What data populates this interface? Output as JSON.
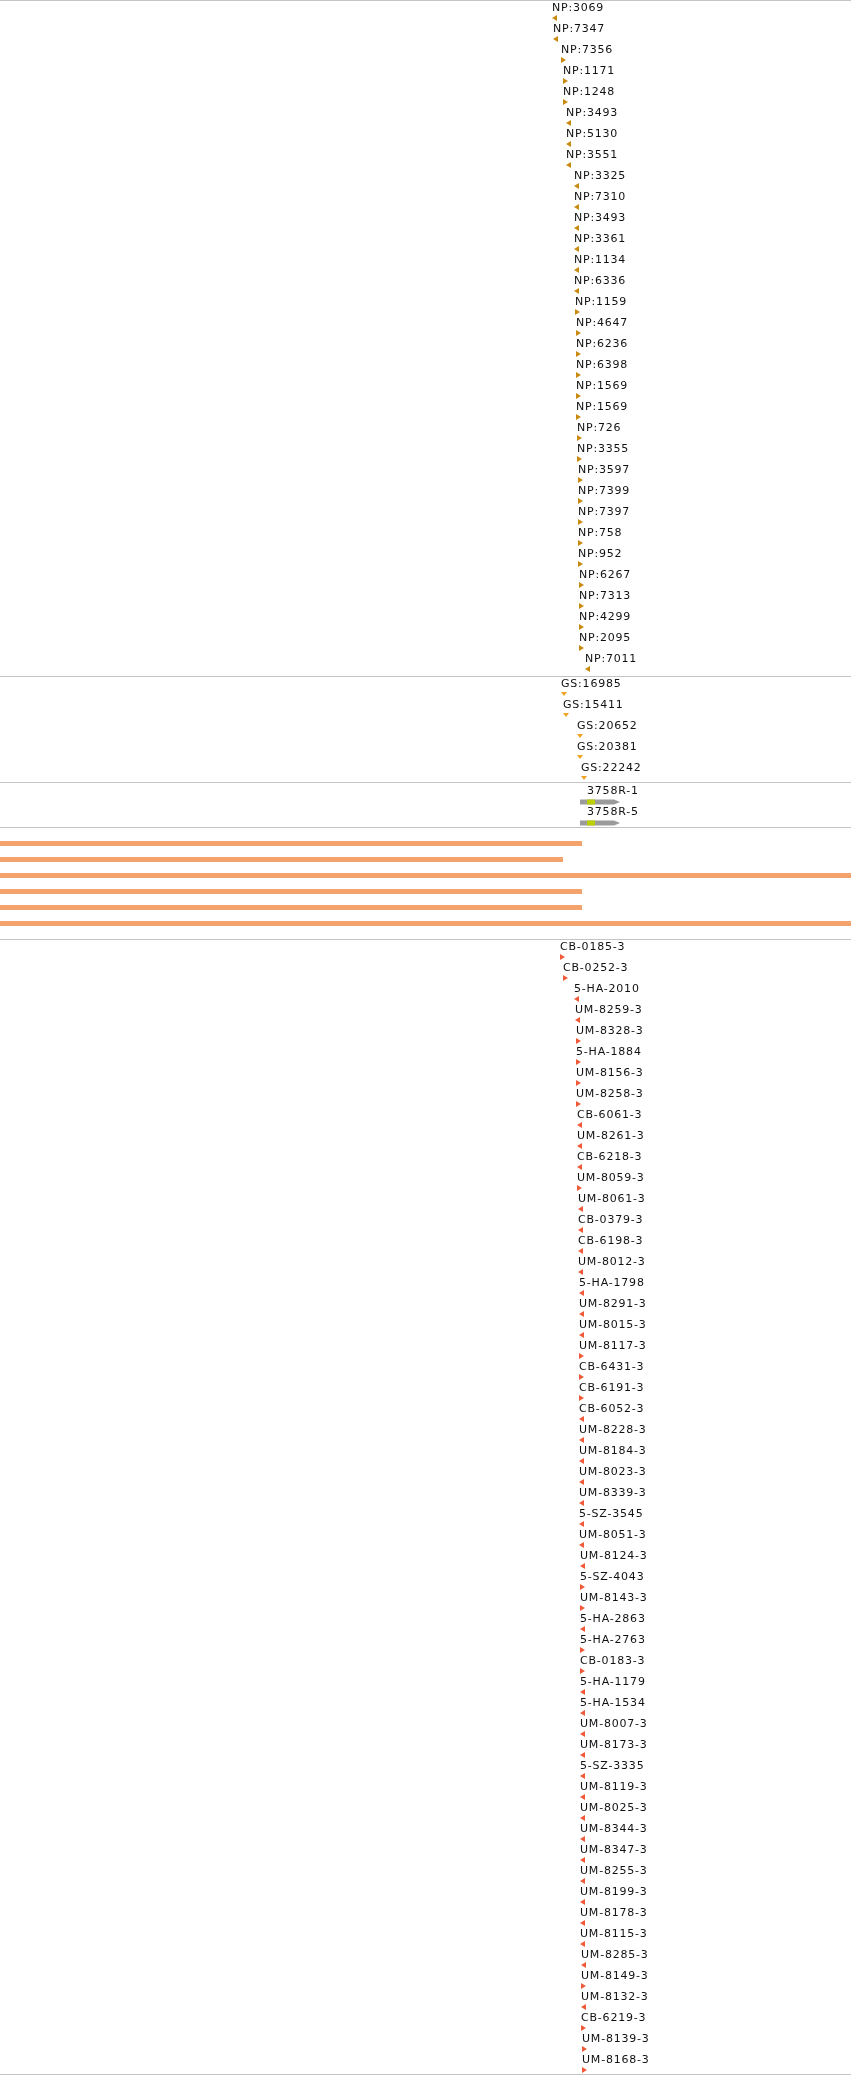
{
  "np_track": {
    "features": [
      {
        "label": "NP:3069",
        "reverse": true
      },
      {
        "label": "NP:7347",
        "reverse": true
      },
      {
        "label": "NP:7356",
        "reverse": false
      },
      {
        "label": "NP:1171",
        "reverse": false
      },
      {
        "label": "NP:1248",
        "reverse": false
      },
      {
        "label": "NP:3493",
        "reverse": true
      },
      {
        "label": "NP:5130",
        "reverse": true
      },
      {
        "label": "NP:3551",
        "reverse": true
      },
      {
        "label": "NP:3325",
        "reverse": true
      },
      {
        "label": "NP:7310",
        "reverse": true
      },
      {
        "label": "NP:3493",
        "reverse": true
      },
      {
        "label": "NP:3361",
        "reverse": true
      },
      {
        "label": "NP:1134",
        "reverse": true
      },
      {
        "label": "NP:6336",
        "reverse": true
      },
      {
        "label": "NP:1159",
        "reverse": false
      },
      {
        "label": "NP:4647",
        "reverse": false
      },
      {
        "label": "NP:6236",
        "reverse": false
      },
      {
        "label": "NP:6398",
        "reverse": false
      },
      {
        "label": "NP:1569",
        "reverse": false
      },
      {
        "label": "NP:1569",
        "reverse": false
      },
      {
        "label": "NP:726",
        "reverse": false
      },
      {
        "label": "NP:3355",
        "reverse": false
      },
      {
        "label": "NP:3597",
        "reverse": false
      },
      {
        "label": "NP:7399",
        "reverse": false
      },
      {
        "label": "NP:7397",
        "reverse": false
      },
      {
        "label": "NP:758",
        "reverse": false
      },
      {
        "label": "NP:952",
        "reverse": false
      },
      {
        "label": "NP:6267",
        "reverse": false
      },
      {
        "label": "NP:7313",
        "reverse": false
      },
      {
        "label": "NP:4299",
        "reverse": false
      },
      {
        "label": "NP:2095",
        "reverse": false
      },
      {
        "label": "NP:7011",
        "reverse": true
      }
    ]
  },
  "gs_track": {
    "features": [
      {
        "label": "GS:16985"
      },
      {
        "label": "GS:15411"
      },
      {
        "label": "GS:20652"
      },
      {
        "label": "GS:20381"
      },
      {
        "label": "GS:22242"
      }
    ]
  },
  "transcript_track": {
    "features": [
      {
        "label": "3758R-1"
      },
      {
        "label": "3758R-5"
      }
    ]
  },
  "cb_track": {
    "features": [
      {
        "label": "CB-0185-3",
        "reverse": false
      },
      {
        "label": "CB-0252-3",
        "reverse": false
      },
      {
        "label": "5-HA-2010",
        "reverse": true
      },
      {
        "label": "UM-8259-3",
        "reverse": true
      },
      {
        "label": "UM-8328-3",
        "reverse": false
      },
      {
        "label": "5-HA-1884",
        "reverse": false
      },
      {
        "label": "UM-8156-3",
        "reverse": false
      },
      {
        "label": "UM-8258-3",
        "reverse": false
      },
      {
        "label": "CB-6061-3",
        "reverse": true
      },
      {
        "label": "UM-8261-3",
        "reverse": true
      },
      {
        "label": "CB-6218-3",
        "reverse": true
      },
      {
        "label": "UM-8059-3",
        "reverse": false
      },
      {
        "label": "UM-8061-3",
        "reverse": true
      },
      {
        "label": "CB-0379-3",
        "reverse": true
      },
      {
        "label": "CB-6198-3",
        "reverse": true
      },
      {
        "label": "UM-8012-3",
        "reverse": true
      },
      {
        "label": "5-HA-1798",
        "reverse": true
      },
      {
        "label": "UM-8291-3",
        "reverse": true
      },
      {
        "label": "UM-8015-3",
        "reverse": true
      },
      {
        "label": "UM-8117-3",
        "reverse": false
      },
      {
        "label": "CB-6431-3",
        "reverse": false
      },
      {
        "label": "CB-6191-3",
        "reverse": false
      },
      {
        "label": "CB-6052-3",
        "reverse": true
      },
      {
        "label": "UM-8228-3",
        "reverse": true
      },
      {
        "label": "UM-8184-3",
        "reverse": true
      },
      {
        "label": "UM-8023-3",
        "reverse": true
      },
      {
        "label": "UM-8339-3",
        "reverse": true
      },
      {
        "label": "5-SZ-3545",
        "reverse": true
      },
      {
        "label": "UM-8051-3",
        "reverse": true
      },
      {
        "label": "UM-8124-3",
        "reverse": true
      },
      {
        "label": "5-SZ-4043",
        "reverse": false
      },
      {
        "label": "UM-8143-3",
        "reverse": false
      },
      {
        "label": "5-HA-2863",
        "reverse": true
      },
      {
        "label": "5-HA-2763",
        "reverse": false
      },
      {
        "label": "CB-0183-3",
        "reverse": false
      },
      {
        "label": "5-HA-1179",
        "reverse": true
      },
      {
        "label": "5-HA-1534",
        "reverse": true
      },
      {
        "label": "UM-8007-3",
        "reverse": true
      },
      {
        "label": "UM-8173-3",
        "reverse": true
      },
      {
        "label": "5-SZ-3335",
        "reverse": true
      },
      {
        "label": "UM-8119-3",
        "reverse": true
      },
      {
        "label": "UM-8025-3",
        "reverse": true
      },
      {
        "label": "UM-8344-3",
        "reverse": true
      },
      {
        "label": "UM-8347-3",
        "reverse": true
      },
      {
        "label": "UM-8255-3",
        "reverse": true
      },
      {
        "label": "UM-8199-3",
        "reverse": true
      },
      {
        "label": "UM-8178-3",
        "reverse": true
      },
      {
        "label": "UM-8115-3",
        "reverse": true
      },
      {
        "label": "UM-8285-3",
        "reverse": true
      },
      {
        "label": "UM-8149-3",
        "reverse": false
      },
      {
        "label": "UM-8132-3",
        "reverse": true
      },
      {
        "label": "CB-6219-3",
        "reverse": false
      },
      {
        "label": "UM-8139-3",
        "reverse": false
      },
      {
        "label": "UM-8168-3",
        "reverse": false
      }
    ]
  }
}
